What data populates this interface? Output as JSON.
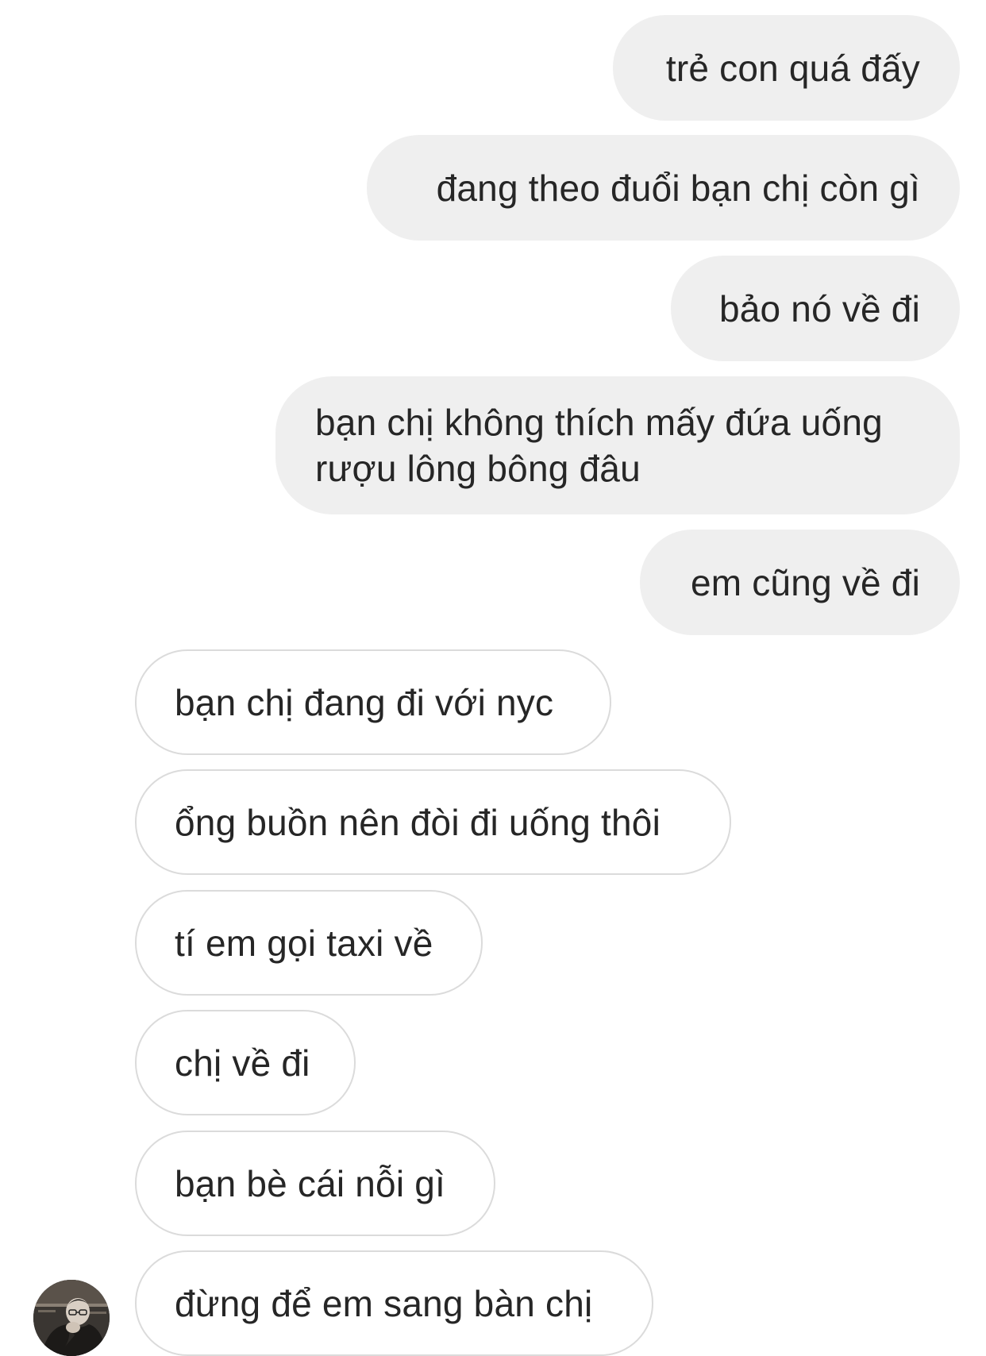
{
  "conversation": {
    "sent_messages": [
      {
        "text": "trẻ con quá đấy"
      },
      {
        "text": "đang theo đuổi bạn chị còn gì"
      },
      {
        "text": "bảo nó về đi"
      },
      {
        "text": "bạn chị không thích mấy đứa uống rượu lông bông đâu"
      },
      {
        "text": "em cũng về đi"
      }
    ],
    "received_messages": [
      {
        "text": "bạn chị đang đi với nyc"
      },
      {
        "text": "ổng buồn nên đòi đi uống thôi"
      },
      {
        "text": "tí em gọi taxi về"
      },
      {
        "text": "chị về đi"
      },
      {
        "text": "bạn bè cái nỗi gì"
      },
      {
        "text": "đừng để em sang bàn chị"
      }
    ]
  },
  "colors": {
    "sent_bubble_bg": "#efefef",
    "received_bubble_border": "#dbdbdb",
    "text": "#262626",
    "background": "#ffffff"
  },
  "icons": {
    "avatar": "contact-avatar-photo"
  }
}
